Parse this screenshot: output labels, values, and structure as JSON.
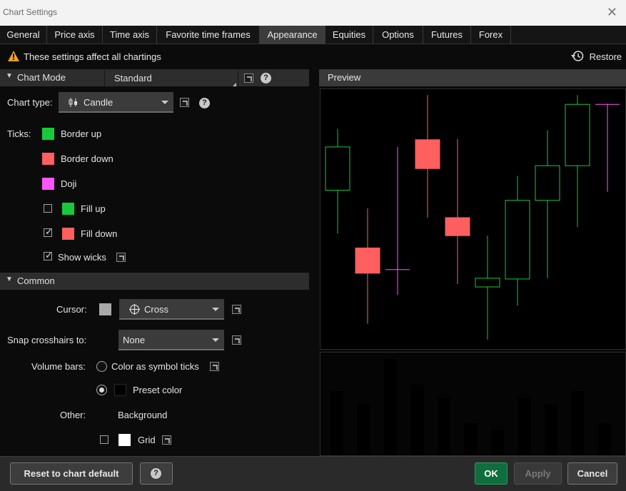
{
  "window": {
    "title": "Chart Settings",
    "close_glyph": "✕"
  },
  "tabs": [
    {
      "label": "General",
      "active": false
    },
    {
      "label": "Price axis",
      "active": false
    },
    {
      "label": "Time axis",
      "active": false
    },
    {
      "label": "Favorite time frames",
      "active": false
    },
    {
      "label": "Appearance",
      "active": true
    },
    {
      "label": "Equities",
      "active": false
    },
    {
      "label": "Options",
      "active": false
    },
    {
      "label": "Futures",
      "active": false
    },
    {
      "label": "Forex",
      "active": false
    }
  ],
  "notice": {
    "icon": "warning-icon",
    "text": "These settings affect all chartings",
    "color": "#f0a020"
  },
  "restore": {
    "icon": "history-icon",
    "label": "Restore"
  },
  "chart_mode": {
    "header": "Chart Mode",
    "value": "Standard"
  },
  "chart_type": {
    "label": "Chart type:",
    "value": "Candle",
    "icon": "candle-icon"
  },
  "ticks": {
    "label": "Ticks:",
    "border_up": {
      "label": "Border up",
      "color": "#19c93c"
    },
    "border_down": {
      "label": "Border down",
      "color": "#ff5f5f"
    },
    "doji": {
      "label": "Doji",
      "color": "#ff55ff"
    },
    "fill_up": {
      "label": "Fill up",
      "checked": false,
      "color": "#19c93c"
    },
    "fill_down": {
      "label": "Fill down",
      "checked": true,
      "color": "#ff5f5f"
    },
    "show_wicks": {
      "label": "Show wicks",
      "checked": true
    }
  },
  "common": {
    "header": "Common",
    "cursor": {
      "label": "Cursor:",
      "value": "Cross",
      "swatch_color": "#a9a9a9",
      "icon": "crosshair-icon"
    },
    "snap": {
      "label": "Snap crosshairs to:",
      "value": "None"
    },
    "volume": {
      "label": "Volume bars:",
      "option_symbol": {
        "label": "Color as symbol ticks",
        "selected": false
      },
      "option_preset": {
        "label": "Preset color",
        "selected": true,
        "color": "#000000"
      }
    },
    "other": {
      "label": "Other:",
      "background": {
        "label": "Background"
      },
      "grid": {
        "label": "Grid",
        "checked": false,
        "color": "#ffffff"
      }
    }
  },
  "preview": {
    "title": "Preview",
    "candles": [
      {
        "o": 220,
        "c": 280,
        "h": 305,
        "l": 160,
        "kind": "up_hollow"
      },
      {
        "o": 140,
        "c": 105,
        "h": 195,
        "l": 35,
        "kind": "down_filled"
      },
      {
        "o": 110,
        "c": 110,
        "h": 280,
        "l": 75,
        "kind": "doji"
      },
      {
        "o": 290,
        "c": 250,
        "h": 352,
        "l": 182,
        "kind": "down_filled"
      },
      {
        "o": 182,
        "c": 157,
        "h": 291,
        "l": 90,
        "kind": "down_filled"
      },
      {
        "o": 86,
        "c": 98,
        "h": 157,
        "l": 13,
        "kind": "up_hollow"
      },
      {
        "o": 97,
        "c": 206,
        "h": 240,
        "l": 60,
        "kind": "up_hollow"
      },
      {
        "o": 206,
        "c": 254,
        "h": 303,
        "l": 98,
        "kind": "up_hollow"
      },
      {
        "o": 254,
        "c": 339,
        "h": 352,
        "l": 169,
        "kind": "up_hollow"
      },
      {
        "o": 339,
        "c": 339,
        "h": 340,
        "l": 218,
        "kind": "doji"
      }
    ],
    "volumes": [
      50,
      40,
      75,
      55,
      45,
      25,
      20,
      45,
      40,
      50,
      25
    ]
  },
  "footer": {
    "reset_label": "Reset to chart default",
    "help_glyph": "?",
    "ok_label": "OK",
    "apply_label": "Apply",
    "cancel_label": "Cancel"
  }
}
